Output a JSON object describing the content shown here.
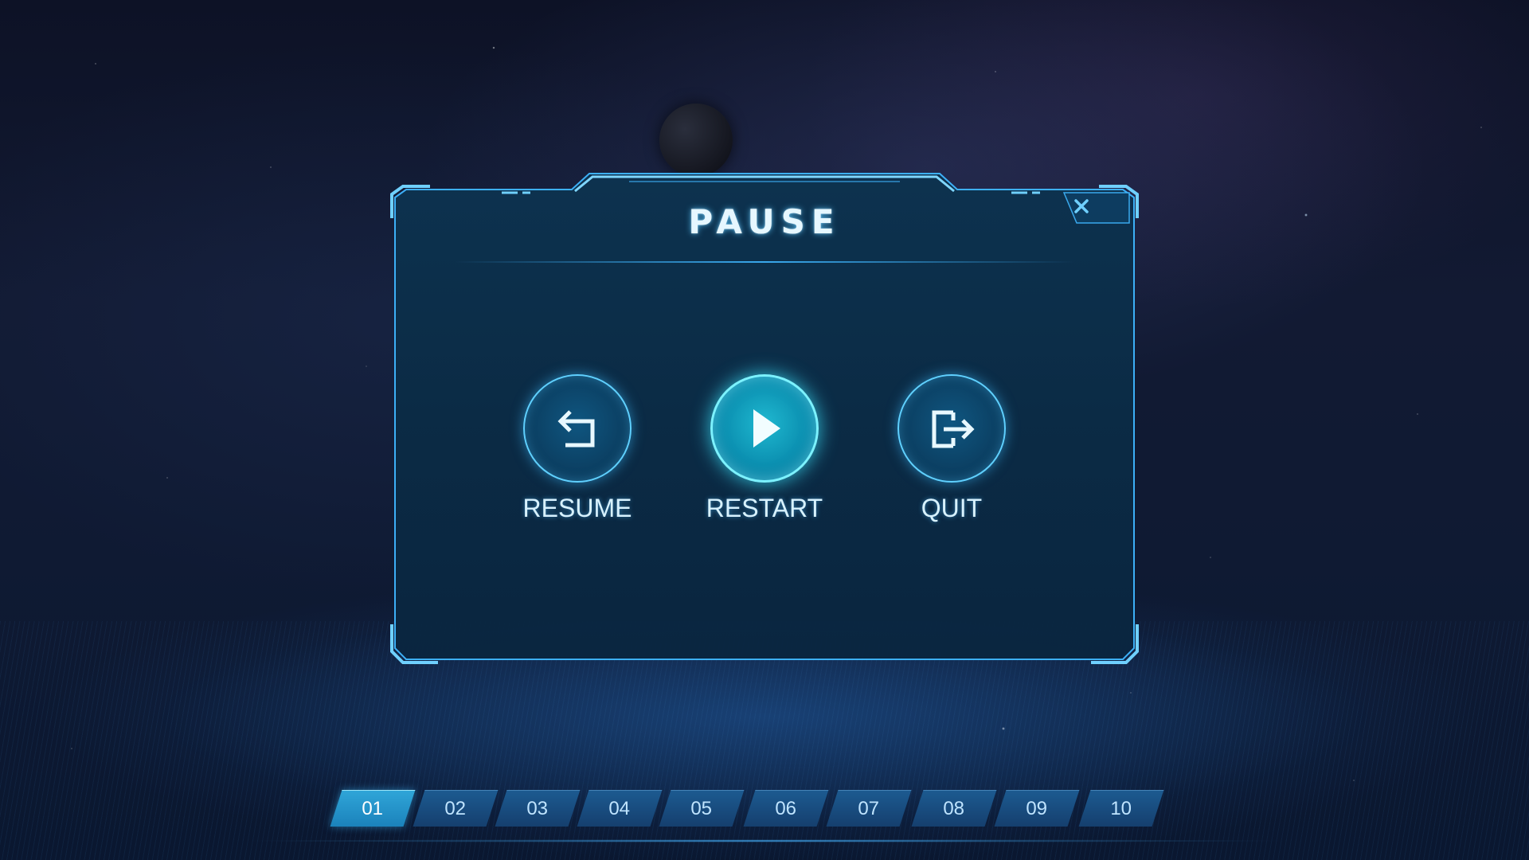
{
  "dialog": {
    "title": "PAUSE",
    "close_icon": "close-icon"
  },
  "actions": [
    {
      "label": "RESUME",
      "icon": "undo-arrow-icon",
      "active": false
    },
    {
      "label": "RESTART",
      "icon": "play-icon",
      "active": true
    },
    {
      "label": "QUIT",
      "icon": "exit-door-icon",
      "active": false
    }
  ],
  "levels": {
    "items": [
      "01",
      "02",
      "03",
      "04",
      "05",
      "06",
      "07",
      "08",
      "09",
      "10"
    ],
    "selected": "01"
  },
  "colors": {
    "accent": "#5fd0ff",
    "active_button": "#1fb8d0",
    "frame": "#3fb6ff",
    "panel": "#0b2c46"
  }
}
